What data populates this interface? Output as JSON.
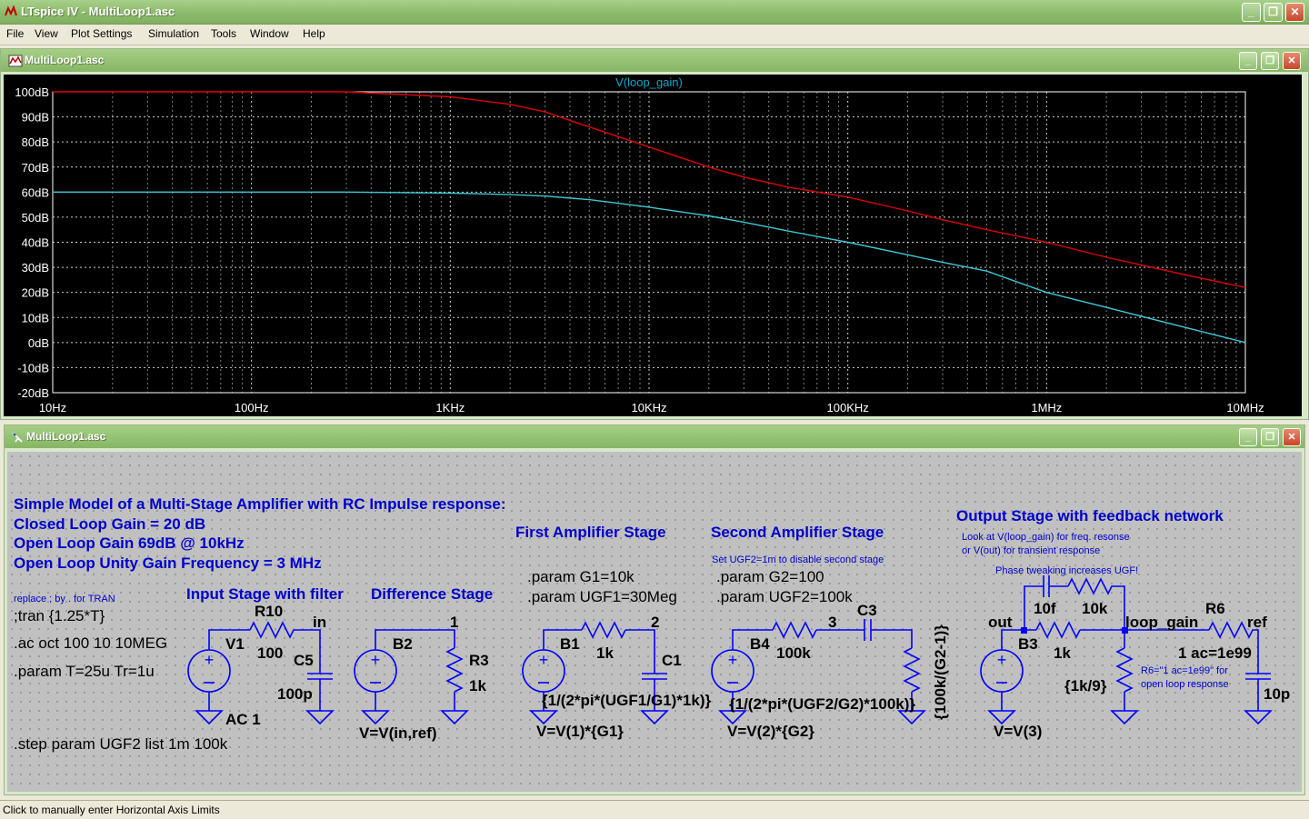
{
  "window": {
    "title": "LTspice IV - MultiLoop1.asc",
    "controls": {
      "minimize": "_",
      "maximize": "❐",
      "close": "✕"
    }
  },
  "menu": [
    "File",
    "View",
    "Plot Settings",
    "Simulation",
    "Tools",
    "Window",
    "Help"
  ],
  "plot_window": {
    "title": "MultiLoop1.asc",
    "trace_label": "V(loop_gain)",
    "colors": {
      "background": "#000000",
      "grid": "#ffffff",
      "axis_text": "#ffffff",
      "title": "#00a8c8",
      "trace_red": "#e00000",
      "trace_cyan": "#3ec8d4"
    }
  },
  "chart_data": {
    "type": "line",
    "title": "V(loop_gain)",
    "x_scale": "log",
    "xlim": [
      10,
      10000000
    ],
    "ylim": [
      -20,
      100
    ],
    "grid": true,
    "x_ticks": [
      {
        "value": 10,
        "label": "10Hz"
      },
      {
        "value": 100,
        "label": "100Hz"
      },
      {
        "value": 1000,
        "label": "1KHz"
      },
      {
        "value": 10000,
        "label": "10KHz"
      },
      {
        "value": 100000,
        "label": "100KHz"
      },
      {
        "value": 1000000,
        "label": "1MHz"
      },
      {
        "value": 10000000,
        "label": "10MHz"
      }
    ],
    "y_ticks": [
      {
        "value": 100,
        "label": "100dB"
      },
      {
        "value": 90,
        "label": "90dB"
      },
      {
        "value": 80,
        "label": "80dB"
      },
      {
        "value": 70,
        "label": "70dB"
      },
      {
        "value": 60,
        "label": "60dB"
      },
      {
        "value": 50,
        "label": "50dB"
      },
      {
        "value": 40,
        "label": "40dB"
      },
      {
        "value": 30,
        "label": "30dB"
      },
      {
        "value": 20,
        "label": "20dB"
      },
      {
        "value": 10,
        "label": "10dB"
      },
      {
        "value": 0,
        "label": "0dB"
      },
      {
        "value": -10,
        "label": "-10dB"
      },
      {
        "value": -20,
        "label": "-20dB"
      }
    ],
    "series": [
      {
        "color": "#e00000",
        "x": [
          10,
          100,
          300,
          1000,
          2000,
          3000,
          5000,
          10000,
          20000,
          30000,
          50000,
          100000,
          200000,
          300000,
          500000,
          1000000,
          2000000,
          5000000,
          10000000
        ],
        "y": [
          100,
          100,
          100,
          98,
          95,
          92,
          86,
          78,
          70,
          66,
          62,
          58,
          52.5,
          49,
          45,
          40,
          34,
          27,
          22
        ]
      },
      {
        "color": "#3ec8d4",
        "x": [
          10,
          100,
          300,
          1000,
          2000,
          3000,
          5000,
          10000,
          20000,
          30000,
          50000,
          100000,
          200000,
          300000,
          500000,
          1000000,
          2000000,
          5000000,
          10000000
        ],
        "y": [
          60,
          60,
          60,
          59.6,
          59,
          58.4,
          57,
          54,
          50.5,
          48,
          44.5,
          40,
          35,
          32,
          28.5,
          20,
          14,
          6,
          0
        ]
      }
    ]
  },
  "schematic_window": {
    "title": "MultiLoop1.asc",
    "colors": {
      "wire": "#0000ff",
      "text": "#000000",
      "title_text": "#0000cc"
    },
    "titles": {
      "main": "Simple Model of a Multi-Stage Amplifier with RC Impulse response:",
      "closed_loop": "Closed Loop Gain = 20 dB",
      "open_loop": "Open Loop Gain 69dB @ 10kHz",
      "ugf": "Open Loop Unity Gain Frequency = 3 MHz",
      "input_stage": "Input Stage with filter",
      "diff_stage": "Difference Stage",
      "first_stage": "First Amplifier Stage",
      "second_stage": "Second Amplifier Stage",
      "output_stage": "Output Stage with feedback network"
    },
    "comments": {
      "replace": "replace ; by . for TRAN",
      "set_ugf2": "Set UGF2=1m to disable second stage",
      "look_at_1": "Look at V(loop_gain) for freq. resonse",
      "look_at_2": "or V(out) for transient response",
      "phase": "Phase tweaking increases UGF!",
      "r6_note_1": "R6=\"1 ac=1e99\" for",
      "r6_note_2": "open loop response"
    },
    "directives": {
      "tran": ";tran {1.25*T}",
      "ac": ".ac oct 100 10 10MEG",
      "param_t": ".param T=25u Tr=1u",
      "step": ".step param UGF2 list 1m 100k",
      "param_g1": ".param G1=10k",
      "param_ugf1": ".param UGF1=30Meg",
      "param_g2": ".param G2=100",
      "param_ugf2": ".param UGF2=100k"
    },
    "labels": {
      "r10": "R10",
      "in": "in",
      "v1": "V1",
      "r10_val": "100",
      "c5": "C5",
      "c5_val": "100p",
      "ac1": "AC 1",
      "b2": "B2",
      "node1a": "1",
      "r3": "R3",
      "r3_val": "1k",
      "b2_expr": "V=V(in,ref)",
      "b1": "B1",
      "node2a": "2",
      "b1_r": "1k",
      "c1": "C1",
      "c1_expr": "{1/(2*pi*(UGF1/G1)*1k)}",
      "b1_expr": "V=V(1)*{G1}",
      "b4": "B4",
      "node3": "3",
      "b4_r": "100k",
      "c3": "C3",
      "c3_expr": "{1/(2*pi*(UGF2/G2)*100k)}",
      "r_vert": "{100k/(G2-1)}",
      "b4_expr": "V=V(2)*{G2}",
      "out": "out",
      "b3": "B3",
      "b3_r": "1k",
      "c10f": "10f",
      "r10k": "10k",
      "loop_gain": "loop_gain",
      "r6": "R6",
      "ref": "ref",
      "r6_val": "1 ac=1e99",
      "r_div": "{1k/9}",
      "c10p": "10p",
      "b3_expr": "V=V(3)"
    }
  },
  "status": "Click to manually enter Horizontal Axis Limits"
}
